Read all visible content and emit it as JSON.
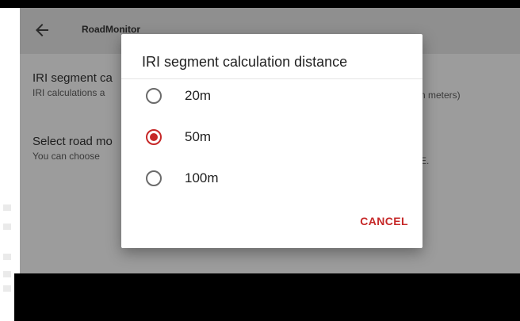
{
  "appbar": {
    "title": "RoadMonitor",
    "back_icon": "arrow-left-icon"
  },
  "preferences": [
    {
      "title": "IRI segment calculation distance",
      "summary": "IRI calculations are performed over segments (in meters)"
    },
    {
      "title": "Select road mode",
      "summary": "You can choose the road type: PAVED or OFF-ROAD ROUTE."
    }
  ],
  "visible_fragments": {
    "pref1_title": "IRI segment ca",
    "pref1_summary_start": "IRI calculations a",
    "pref1_summary_end": "n meters)",
    "pref2_title": "Select road mo",
    "pref2_summary_start": "You can choose",
    "pref2_summary_end": "E.",
    "appbar_title_visible": "RoadMonitor"
  },
  "dialog": {
    "title": "IRI segment calculation distance",
    "options": [
      {
        "label": "20m",
        "selected": false
      },
      {
        "label": "50m",
        "selected": true
      },
      {
        "label": "100m",
        "selected": false
      }
    ],
    "cancel_label": "CANCEL"
  },
  "colors": {
    "accent": "#c62828",
    "scrim": "#9c9c9c"
  }
}
